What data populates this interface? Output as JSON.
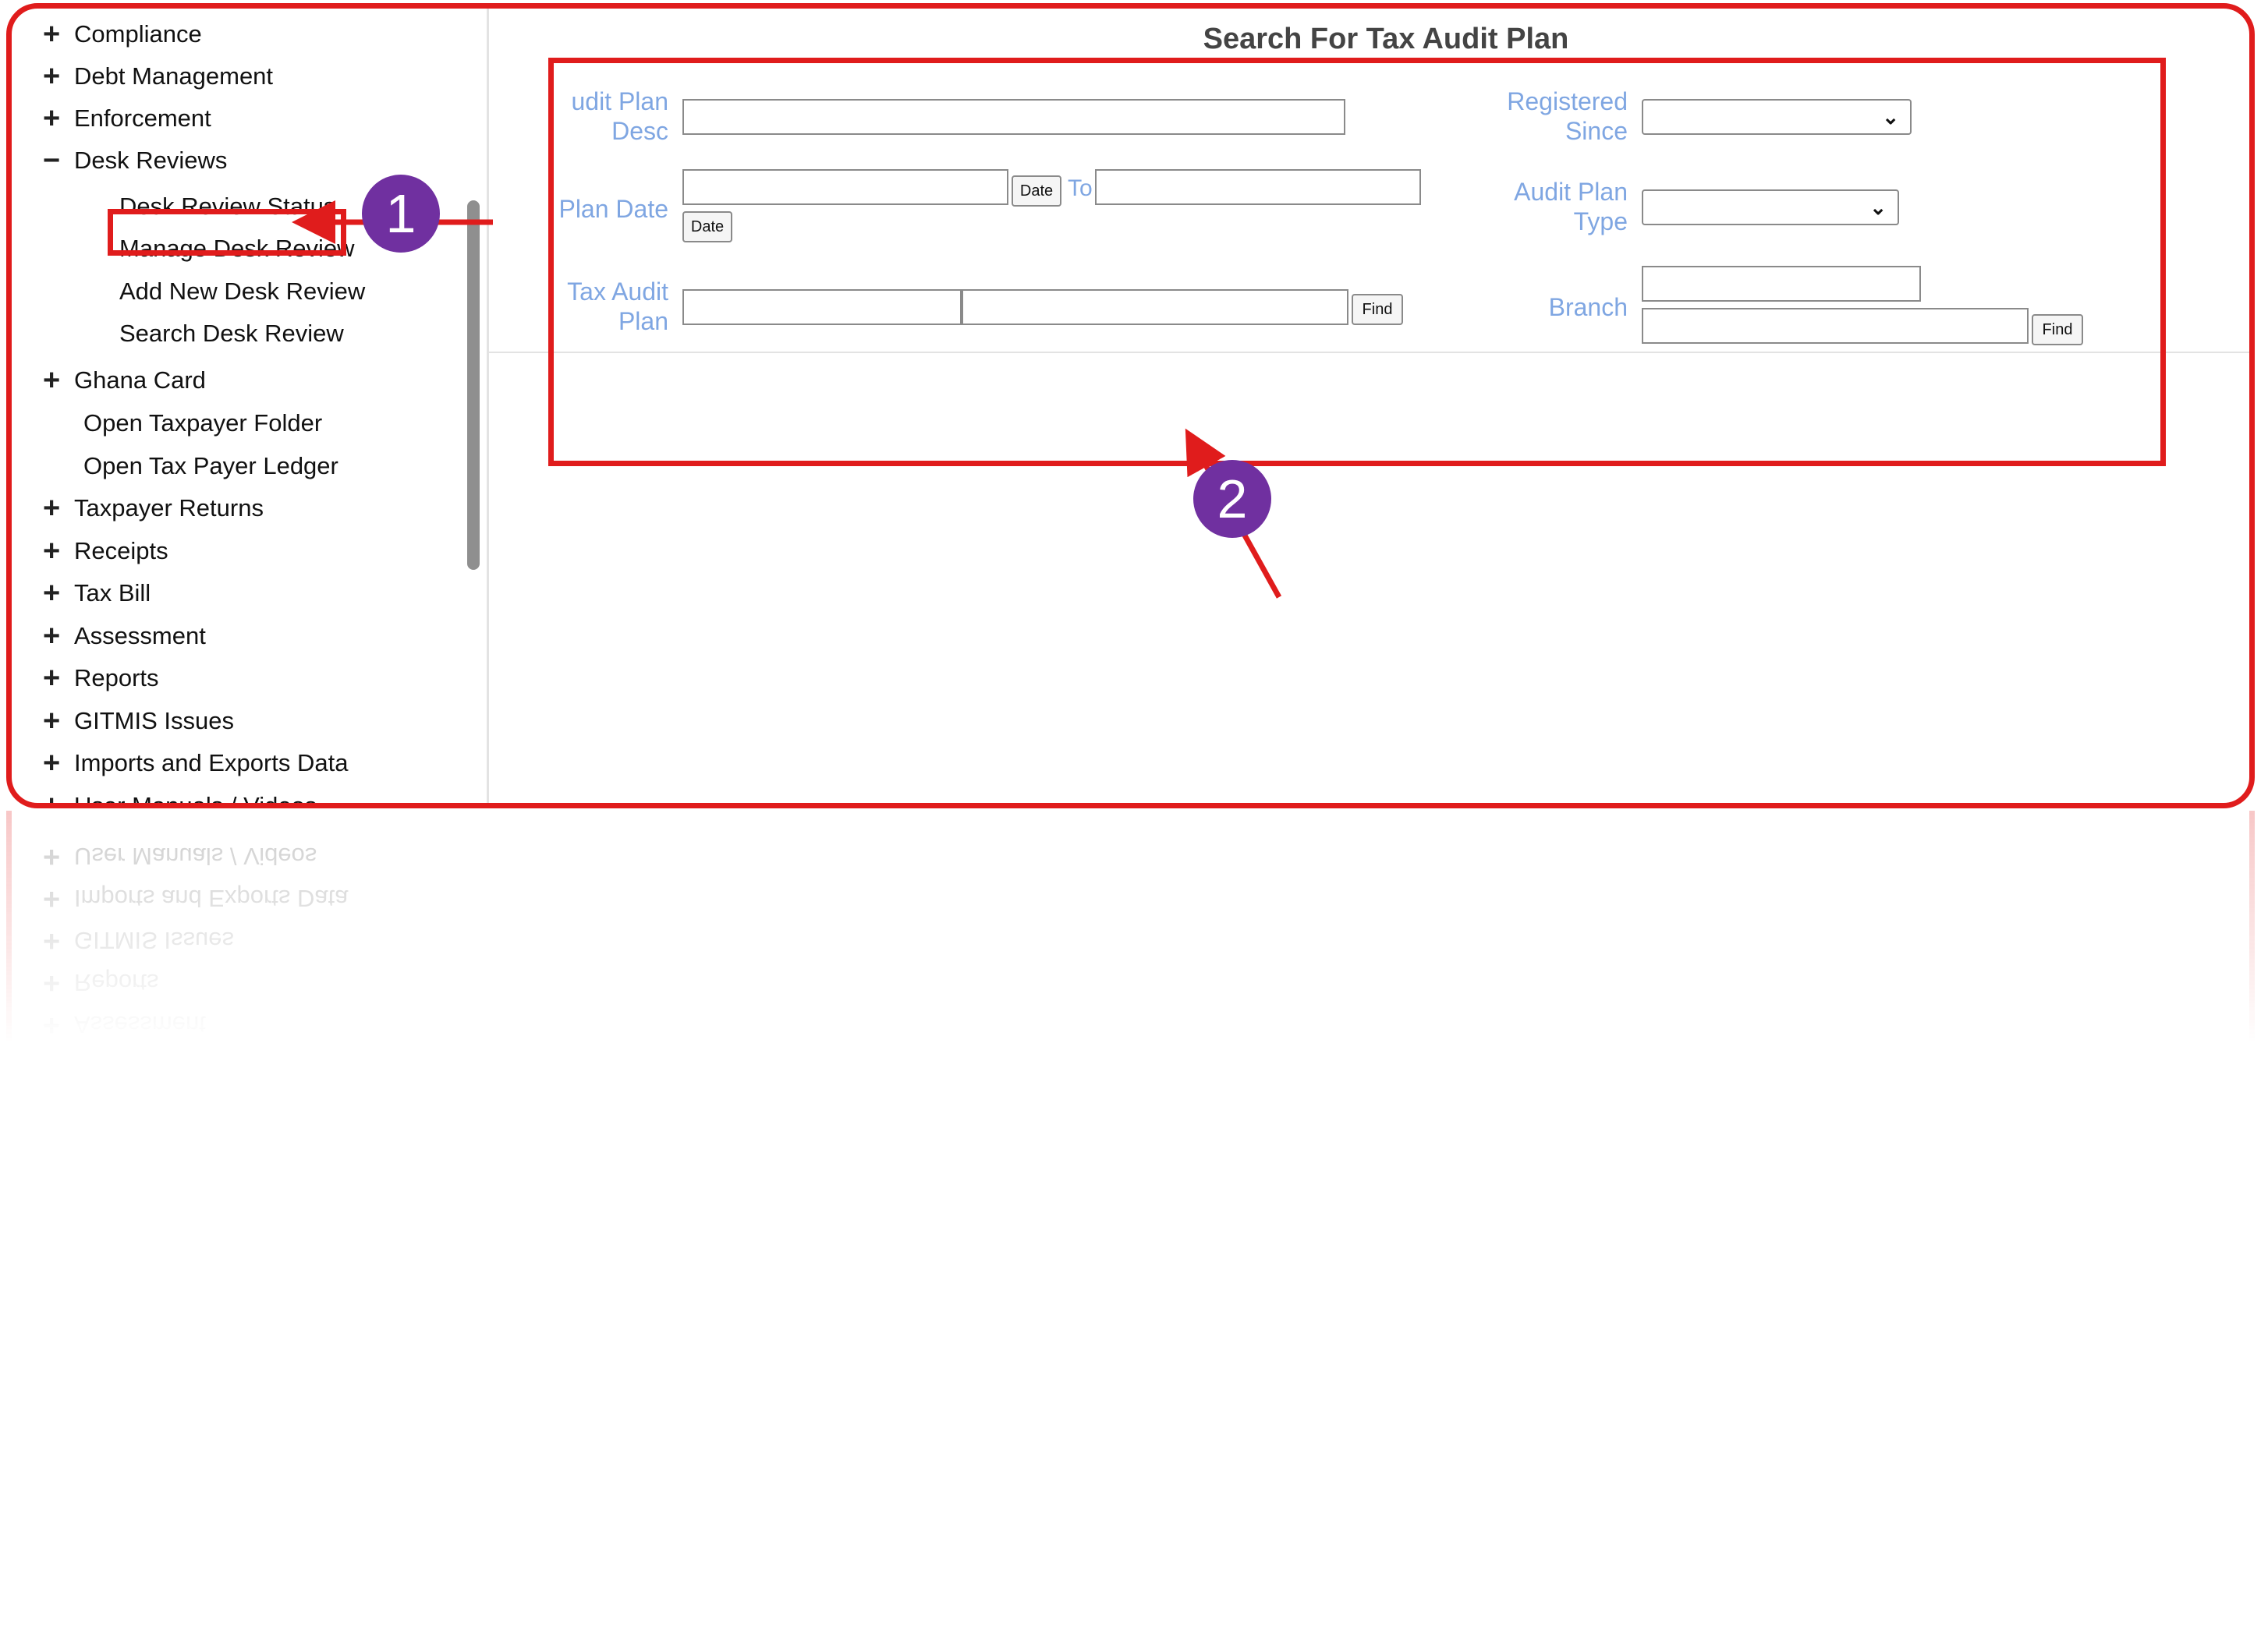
{
  "sidebar": {
    "items": [
      {
        "label": "Compliance",
        "symbol": "+"
      },
      {
        "label": "Debt Management",
        "symbol": "+"
      },
      {
        "label": "Enforcement",
        "symbol": "+"
      },
      {
        "label": "Desk Reviews",
        "symbol": "−"
      },
      {
        "label": "Desk Review Status",
        "symbol": ""
      },
      {
        "label": "Manage Desk Review",
        "symbol": ""
      },
      {
        "label": "Add New Desk Review",
        "symbol": ""
      },
      {
        "label": "Search Desk Review",
        "symbol": ""
      },
      {
        "label": "Ghana Card",
        "symbol": "+"
      },
      {
        "label": "Open Taxpayer Folder",
        "symbol": ""
      },
      {
        "label": "Open Tax Payer Ledger",
        "symbol": ""
      },
      {
        "label": "Taxpayer Returns",
        "symbol": "+"
      },
      {
        "label": "Receipts",
        "symbol": "+"
      },
      {
        "label": "Tax Bill",
        "symbol": "+"
      },
      {
        "label": "Assessment",
        "symbol": "+"
      },
      {
        "label": "Reports",
        "symbol": "+"
      },
      {
        "label": "GITMIS Issues",
        "symbol": "+"
      },
      {
        "label": "Imports and Exports Data",
        "symbol": "+"
      },
      {
        "label": "User Manuals / Videos",
        "symbol": "+"
      }
    ]
  },
  "form": {
    "title": "Search For Tax Audit Plan",
    "audit_plan_desc_label_1": "udit Plan",
    "audit_plan_desc_label_2": "Desc",
    "plan_date_label": "Plan Date",
    "tax_audit_plan_label_1": "Tax Audit",
    "tax_audit_plan_label_2": "Plan",
    "registered_since_label_1": "Registered",
    "registered_since_label_2": "Since",
    "audit_plan_type_label_1": "Audit Plan",
    "audit_plan_type_label_2": "Type",
    "branch_label": "Branch",
    "date_button": "Date",
    "to_label": "To",
    "find_button": "Find",
    "audit_plan_desc_value": "",
    "plan_date_from_value": "",
    "plan_date_to_value": "",
    "tax_audit_plan_code_value": "",
    "tax_audit_plan_name_value": "",
    "branch_code_value": "",
    "branch_name_value": "",
    "registered_since_selected": "",
    "audit_plan_type_selected": ""
  },
  "annotations": {
    "badge_1": "1",
    "badge_2": "2",
    "color": "#e01c1c",
    "badge_color": "#7030a0"
  },
  "reflection_items": [
    {
      "label": "User Manuals / Videos",
      "symbol": "+"
    },
    {
      "label": "Imports and Exports Data",
      "symbol": "+"
    },
    {
      "label": "GITMIS Issues",
      "symbol": "+"
    },
    {
      "label": "Reports",
      "symbol": "+"
    },
    {
      "label": "Assessment",
      "symbol": "+"
    }
  ],
  "icons": {
    "expand": "plus-icon",
    "collapse": "minus-icon",
    "dropdown": "chevron-down-icon"
  }
}
